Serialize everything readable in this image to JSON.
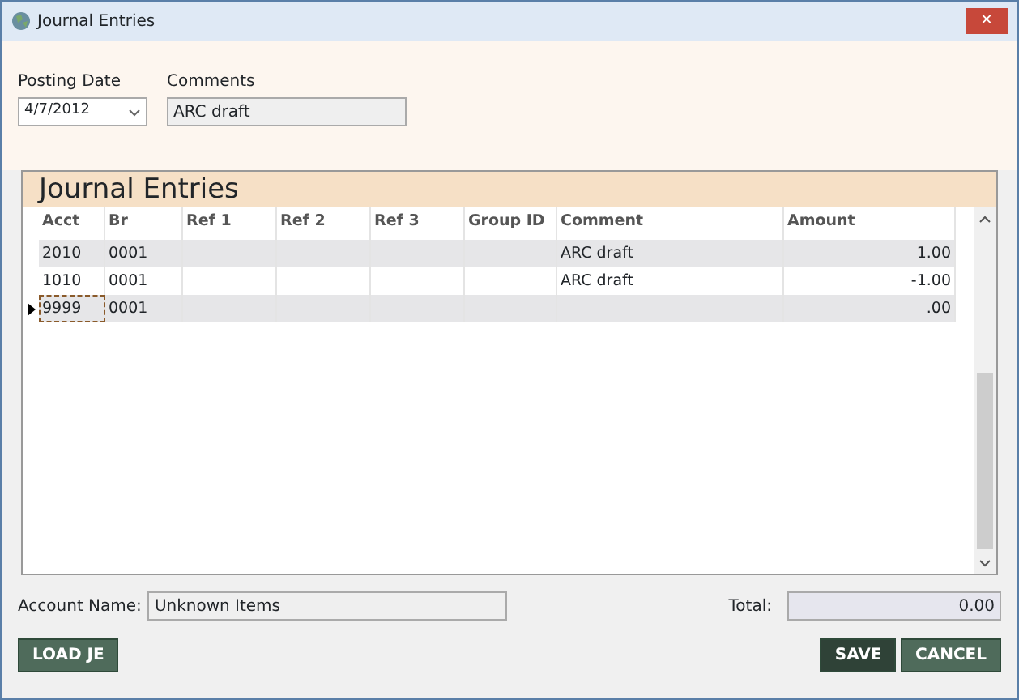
{
  "window": {
    "title": "Journal Entries",
    "close": "✕"
  },
  "posting_date": {
    "label": "Posting Date",
    "value": "4/7/2012"
  },
  "comments": {
    "label": "Comments",
    "value": "ARC draft"
  },
  "grid": {
    "title": "Journal Entries",
    "columns": [
      "Acct",
      "Br",
      "Ref 1",
      "Ref 2",
      "Ref 3",
      "Group ID",
      "Comment",
      "Amount"
    ],
    "rows": [
      {
        "cells": [
          "2010",
          "0001",
          "",
          "",
          "",
          "",
          "ARC draft",
          "1.00"
        ],
        "current": false
      },
      {
        "cells": [
          "1010",
          "0001",
          "",
          "",
          "",
          "",
          "ARC draft",
          "-1.00"
        ],
        "current": false
      },
      {
        "cells": [
          "9999",
          "0001",
          "",
          "",
          "",
          "",
          "",
          ".00"
        ],
        "current": true
      }
    ]
  },
  "account_name": {
    "label": "Account Name:",
    "value": "Unknown Items"
  },
  "total": {
    "label": "Total:",
    "value": "0.00"
  },
  "buttons": [
    {
      "label": "LOAD JE",
      "kind": "secondary"
    },
    {
      "label": "SAVE",
      "kind": "primary"
    },
    {
      "label": "CANCEL",
      "kind": "secondary"
    }
  ]
}
